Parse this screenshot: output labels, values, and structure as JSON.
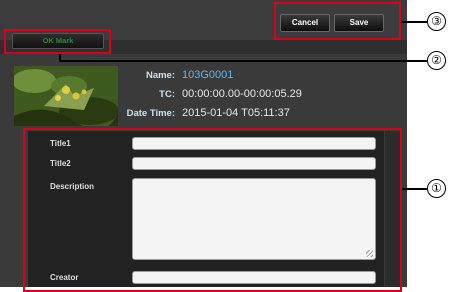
{
  "header": {
    "cancel_label": "Cancel",
    "save_label": "Save"
  },
  "toolbar": {
    "ok_mark_label": "OK Mark"
  },
  "clip_info": {
    "name_label": "Name:",
    "name_value": "103G0001",
    "tc_label": "TC:",
    "tc_value": "00:00:00.00-00:00:05.29",
    "datetime_label": "Date Time:",
    "datetime_value": "2015-01-04 T05:11:37"
  },
  "form": {
    "title1_label": "Title1",
    "title2_label": "Title2",
    "description_label": "Description",
    "creator_label": "Creator",
    "title1_value": "",
    "title2_value": "",
    "description_value": "",
    "creator_value": ""
  },
  "callouts": {
    "one": "①",
    "two": "②",
    "three": "③"
  },
  "colors": {
    "callout_box": "#d9001b",
    "name_value": "#6fb1e4",
    "ok_mark_text": "#2a8a2a"
  },
  "icons": {
    "thumbnail": "clip-thumbnail-icon"
  }
}
